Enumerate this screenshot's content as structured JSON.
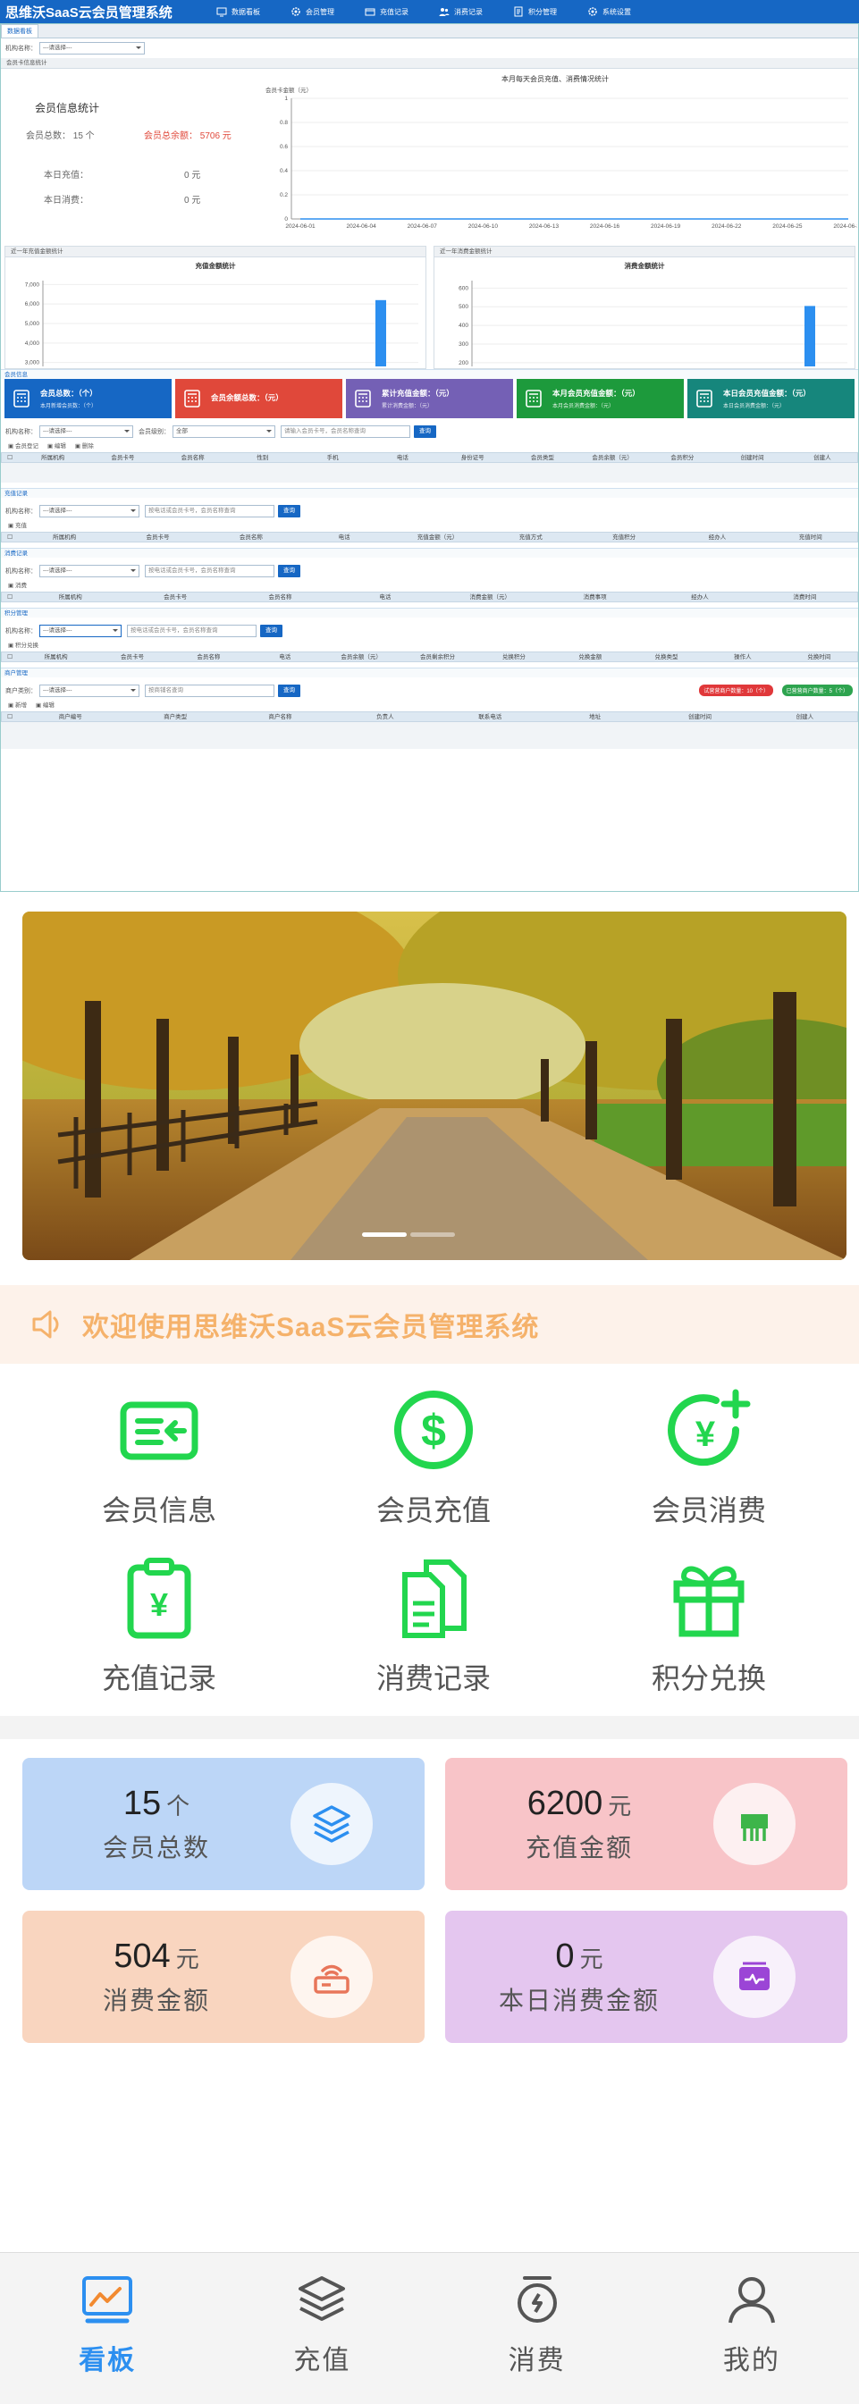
{
  "app": {
    "title": "思维沃SaaS云会员管理系统"
  },
  "nav": [
    {
      "label": "数据看板",
      "icon": "monitor-icon"
    },
    {
      "label": "会员管理",
      "icon": "gear-icon"
    },
    {
      "label": "充值记录",
      "icon": "card-icon"
    },
    {
      "label": "消费记录",
      "icon": "users-icon"
    },
    {
      "label": "积分管理",
      "icon": "document-icon"
    },
    {
      "label": "系统设置",
      "icon": "gear-icon"
    }
  ],
  "admin": {
    "tab": "数据看板",
    "filter": {
      "label": "机构名称：",
      "select": "---请选择---"
    },
    "member_panel": {
      "header": "会员卡信息统计",
      "title": "会员信息统计",
      "total_label": "会员总数：",
      "total_value": "15 个",
      "balance_label": "会员总余额：",
      "balance_value": "5706 元",
      "today_recharge_label": "本日充值：",
      "today_recharge_value": "0 元",
      "today_consume_label": "本日消费：",
      "today_consume_value": "0 元"
    },
    "daily_chart": {
      "title": "本月每天会员充值、消费情况统计",
      "ylabel": "会员卡金额（元）"
    },
    "recharge_panel": {
      "header": "近一年充值金额统计",
      "title": "充值金额统计"
    },
    "consume_panel": {
      "header": "近一年消费金额统计",
      "title": "消费金额统计"
    },
    "member_section": {
      "header": "会员信息",
      "cards": [
        {
          "title": "会员总数：（个）",
          "sub": "本月新增会员数：（个）",
          "color": "#1667c4"
        },
        {
          "title": "会员余额总数：（元）",
          "sub": "",
          "color": "#e0483a"
        },
        {
          "title": "累计充值金额：（元）",
          "sub": "累计消费金额：（元）",
          "color": "#7460b5"
        },
        {
          "title": "本月会员充值金额：（元）",
          "sub": "本月会员消费金额：（元）",
          "color": "#1d9a3c"
        },
        {
          "title": "本日会员充值金额：（元）",
          "sub": "本日会员消费金额：（元）",
          "color": "#16867c"
        }
      ],
      "filter": {
        "org_label": "机构名称：",
        "org": "---请选择---",
        "level_label": "会员级别：",
        "level": "全部",
        "placeholder": "请输入会员卡号，会员名称查询",
        "search": "查询"
      },
      "toolbar": [
        "会员登记",
        "编辑",
        "删除"
      ],
      "columns": [
        "所属机构",
        "会员卡号",
        "会员名称",
        "性别",
        "手机",
        "电话",
        "身份证号",
        "会员类型",
        "会员余额（元）",
        "会员积分",
        "创建时间",
        "创建人"
      ]
    },
    "recharge_section": {
      "header": "充值记录",
      "filter": {
        "org_label": "机构名称：",
        "org": "---请选择---",
        "placeholder": "按电话或会员卡号，会员名称查询",
        "search": "查询"
      },
      "toolbar": [
        "充值"
      ],
      "columns": [
        "所属机构",
        "会员卡号",
        "会员名称",
        "电话",
        "充值金额（元）",
        "充值方式",
        "充值积分",
        "经办人",
        "充值时间"
      ]
    },
    "consume_section": {
      "header": "消费记录",
      "filter": {
        "org_label": "机构名称：",
        "org": "---请选择---",
        "placeholder": "按电话或会员卡号，会员名称查询",
        "search": "查询"
      },
      "toolbar": [
        "消费"
      ],
      "columns": [
        "所属机构",
        "会员卡号",
        "会员名称",
        "电话",
        "消费金额（元）",
        "消费事项",
        "经办人",
        "消费时间"
      ]
    },
    "points_section": {
      "header": "积分管理",
      "filter": {
        "org_label": "机构名称：",
        "org": "---请选择---",
        "placeholder": "按电话或会员卡号，会员名称查询",
        "search": "查询"
      },
      "toolbar": [
        "积分兑换"
      ],
      "columns": [
        "所属机构",
        "会员卡号",
        "会员名称",
        "电话",
        "会员余额（元）",
        "会员剩余积分",
        "兑换积分",
        "兑换金额",
        "兑换类型",
        "操作人",
        "兑换时间"
      ]
    },
    "account_section": {
      "header": "商户管理",
      "filter": {
        "label": "商户类别：",
        "select": "---请选择---",
        "placeholder": "按商铺名查询",
        "search": "查询"
      },
      "badge_red": "试营营商户数量：10（个）",
      "badge_green": "已营营商户数量：5（个）",
      "toolbar": [
        "新增",
        "编辑"
      ],
      "columns": [
        "商户编号",
        "商户类型",
        "商户名称",
        "负责人",
        "联系电话",
        "地址",
        "创建时间",
        "创建人"
      ]
    }
  },
  "mobile": {
    "notice": "欢迎使用思维沃SaaS云会员管理系统",
    "menu": [
      {
        "label": "会员信息",
        "icon": "member-card-icon"
      },
      {
        "label": "会员充值",
        "icon": "dollar-coin-icon"
      },
      {
        "label": "会员消费",
        "icon": "yuan-plus-icon"
      },
      {
        "label": "充值记录",
        "icon": "clipboard-yuan-icon"
      },
      {
        "label": "消费记录",
        "icon": "documents-icon"
      },
      {
        "label": "积分兑换",
        "icon": "gift-icon"
      }
    ],
    "stats": [
      {
        "value": "15",
        "unit": "个",
        "label": "会员总数",
        "color": "#bcd6f7",
        "icon": "layers-icon"
      },
      {
        "value": "6200",
        "unit": "元",
        "label": "充值金额",
        "color": "#f8c4c8",
        "icon": "stool-icon"
      },
      {
        "value": "504",
        "unit": "元",
        "label": "消费金额",
        "color": "#f9d5bf",
        "icon": "router-icon"
      },
      {
        "value": "0",
        "unit": "元",
        "label": "本日消费金额",
        "color": "#e4c6ef",
        "icon": "wallet-icon"
      }
    ],
    "tabs": [
      {
        "label": "看板",
        "icon": "chart-icon",
        "active": true
      },
      {
        "label": "充值",
        "icon": "layers-icon",
        "active": false
      },
      {
        "label": "消费",
        "icon": "timer-icon",
        "active": false
      },
      {
        "label": "我的",
        "icon": "user-icon",
        "active": false
      }
    ]
  },
  "chart_data": [
    {
      "type": "line",
      "title": "本月每天会员充值、消费情况统计",
      "ylabel": "会员卡金额（元）",
      "x": [
        "2024-06-01",
        "2024-06-04",
        "2024-06-07",
        "2024-06-10",
        "2024-06-13",
        "2024-06-16",
        "2024-06-19",
        "2024-06-22",
        "2024-06-25",
        "2024-06-28"
      ],
      "y": [
        0,
        0,
        0,
        0,
        0,
        0,
        0,
        0,
        0,
        0
      ],
      "ylim": [
        0,
        1
      ],
      "yticks": [
        0,
        0.2,
        0.4,
        0.6,
        0.8,
        1
      ]
    },
    {
      "type": "bar",
      "title": "充值金额统计",
      "yticks": [
        3000,
        4000,
        5000,
        6000,
        7000
      ],
      "values": [
        6200
      ],
      "ylim": [
        2800,
        7200
      ]
    },
    {
      "type": "bar",
      "title": "消费金额统计",
      "yticks": [
        200,
        300,
        400,
        500,
        600
      ],
      "values": [
        504
      ],
      "ylim": [
        180,
        640
      ]
    }
  ]
}
